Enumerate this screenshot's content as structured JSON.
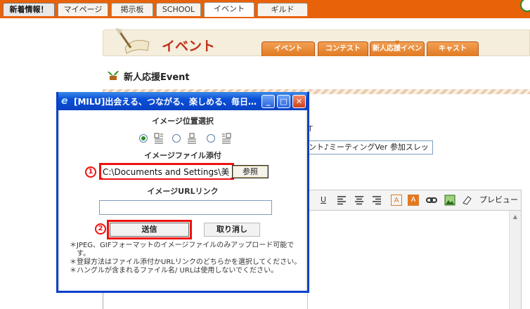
{
  "nav": {
    "tabs": [
      {
        "label": "新着情報！"
      },
      {
        "label": "マイページ"
      },
      {
        "label": "掲示板"
      },
      {
        "label": "SCHOOL"
      },
      {
        "label": "イベント"
      },
      {
        "label": "ギルド"
      }
    ],
    "active_tab": "イベント"
  },
  "event_page": {
    "title": "イベント",
    "tabs": [
      {
        "label": "イベント"
      },
      {
        "label": "コンテスト"
      },
      {
        "label": "新人応援イベント"
      },
      {
        "label": "キャスト"
      }
    ],
    "subtitle": "新人応援Event",
    "bg_fragment_t": "T",
    "bg_title_value": "ント♪ミーティングVer 参加スレッ",
    "editor_preview_label": "プレビュー",
    "editor_toolbar_icons": [
      "underline-icon",
      "align-left-icon",
      "align-center-icon",
      "align-right-icon",
      "font-color-icon",
      "highlight-icon",
      "link-icon",
      "image-icon",
      "eraser-icon"
    ]
  },
  "popup": {
    "title": "[MILU]出会える、つながる、楽しめる、毎日…",
    "section_position": "イメージ位置選択",
    "position_options": [
      "left",
      "center",
      "right"
    ],
    "selected_position": "left",
    "section_file": "イメージファイル添付",
    "file_path_value": "C:\\Documents and Settings\\美",
    "browse_label": "参照",
    "badge_1": "1",
    "section_url": "イメージURLリンク",
    "url_value": "",
    "badge_2": "2",
    "submit_label": "送信",
    "cancel_label": "取り消し",
    "notes": [
      "＊JPEG、GIFフォーマットのイメージファイルのみアップロード可能です。",
      "＊登録方法はファイル添付かURLリンクのどちらかを選択してください。",
      "＊ハングルが含まれるファイル名/ URLは使用しないでください。"
    ]
  },
  "colors": {
    "nav_bar": "#e8620a",
    "event_tab": "#e07a22",
    "highlight_box": "#ee1111",
    "window_frame": "#0a3fc9"
  }
}
